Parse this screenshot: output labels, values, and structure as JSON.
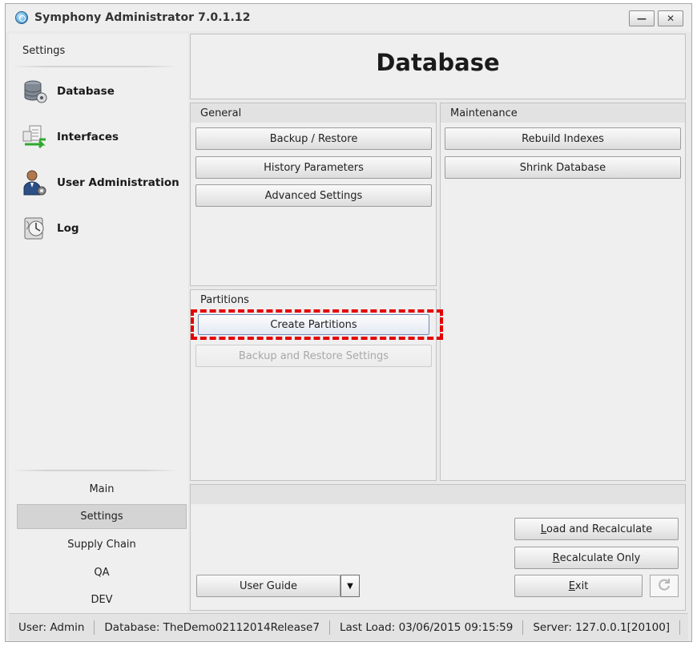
{
  "window": {
    "title": "Symphony Administrator 7.0.1.12",
    "minimize_glyph": "—",
    "close_glyph": "✕"
  },
  "sidebar": {
    "header": "Settings",
    "items": [
      {
        "label": "Database",
        "icon": "database-icon"
      },
      {
        "label": "Interfaces",
        "icon": "interfaces-icon"
      },
      {
        "label": "User Administration",
        "icon": "user-admin-icon"
      },
      {
        "label": "Log",
        "icon": "log-icon"
      }
    ],
    "bottom_nav": [
      {
        "label": "Main",
        "active": false
      },
      {
        "label": "Settings",
        "active": true
      },
      {
        "label": "Supply Chain",
        "active": false
      },
      {
        "label": "QA",
        "active": false
      },
      {
        "label": "DEV",
        "active": false
      }
    ]
  },
  "main": {
    "title": "Database",
    "general": {
      "title": "General",
      "buttons": [
        "Backup / Restore",
        "History Parameters",
        "Advanced Settings"
      ]
    },
    "maintenance": {
      "title": "Maintenance",
      "buttons": [
        "Rebuild Indexes",
        "Shrink Database"
      ]
    },
    "partitions": {
      "title": "Partitions",
      "create_label": "Create Partitions",
      "backup_settings_label": "Backup and Restore Settings"
    }
  },
  "actions": {
    "user_guide": "User Guide",
    "dropdown_glyph": "▼",
    "load_recalc_first": "L",
    "load_recalc_rest": "oad and Recalculate",
    "recalc_first": "R",
    "recalc_rest": "ecalculate Only",
    "exit_first": "E",
    "exit_rest": "xit"
  },
  "status": {
    "user": "User: Admin",
    "database": "Database: TheDemo02112014Release7",
    "last_load": "Last Load: 03/06/2015 09:15:59",
    "server": "Server: 127.0.0.1[20100]"
  },
  "colors": {
    "highlight": "#e30000",
    "window_bg": "#e9e9e9",
    "panel_bg": "#efefef"
  }
}
